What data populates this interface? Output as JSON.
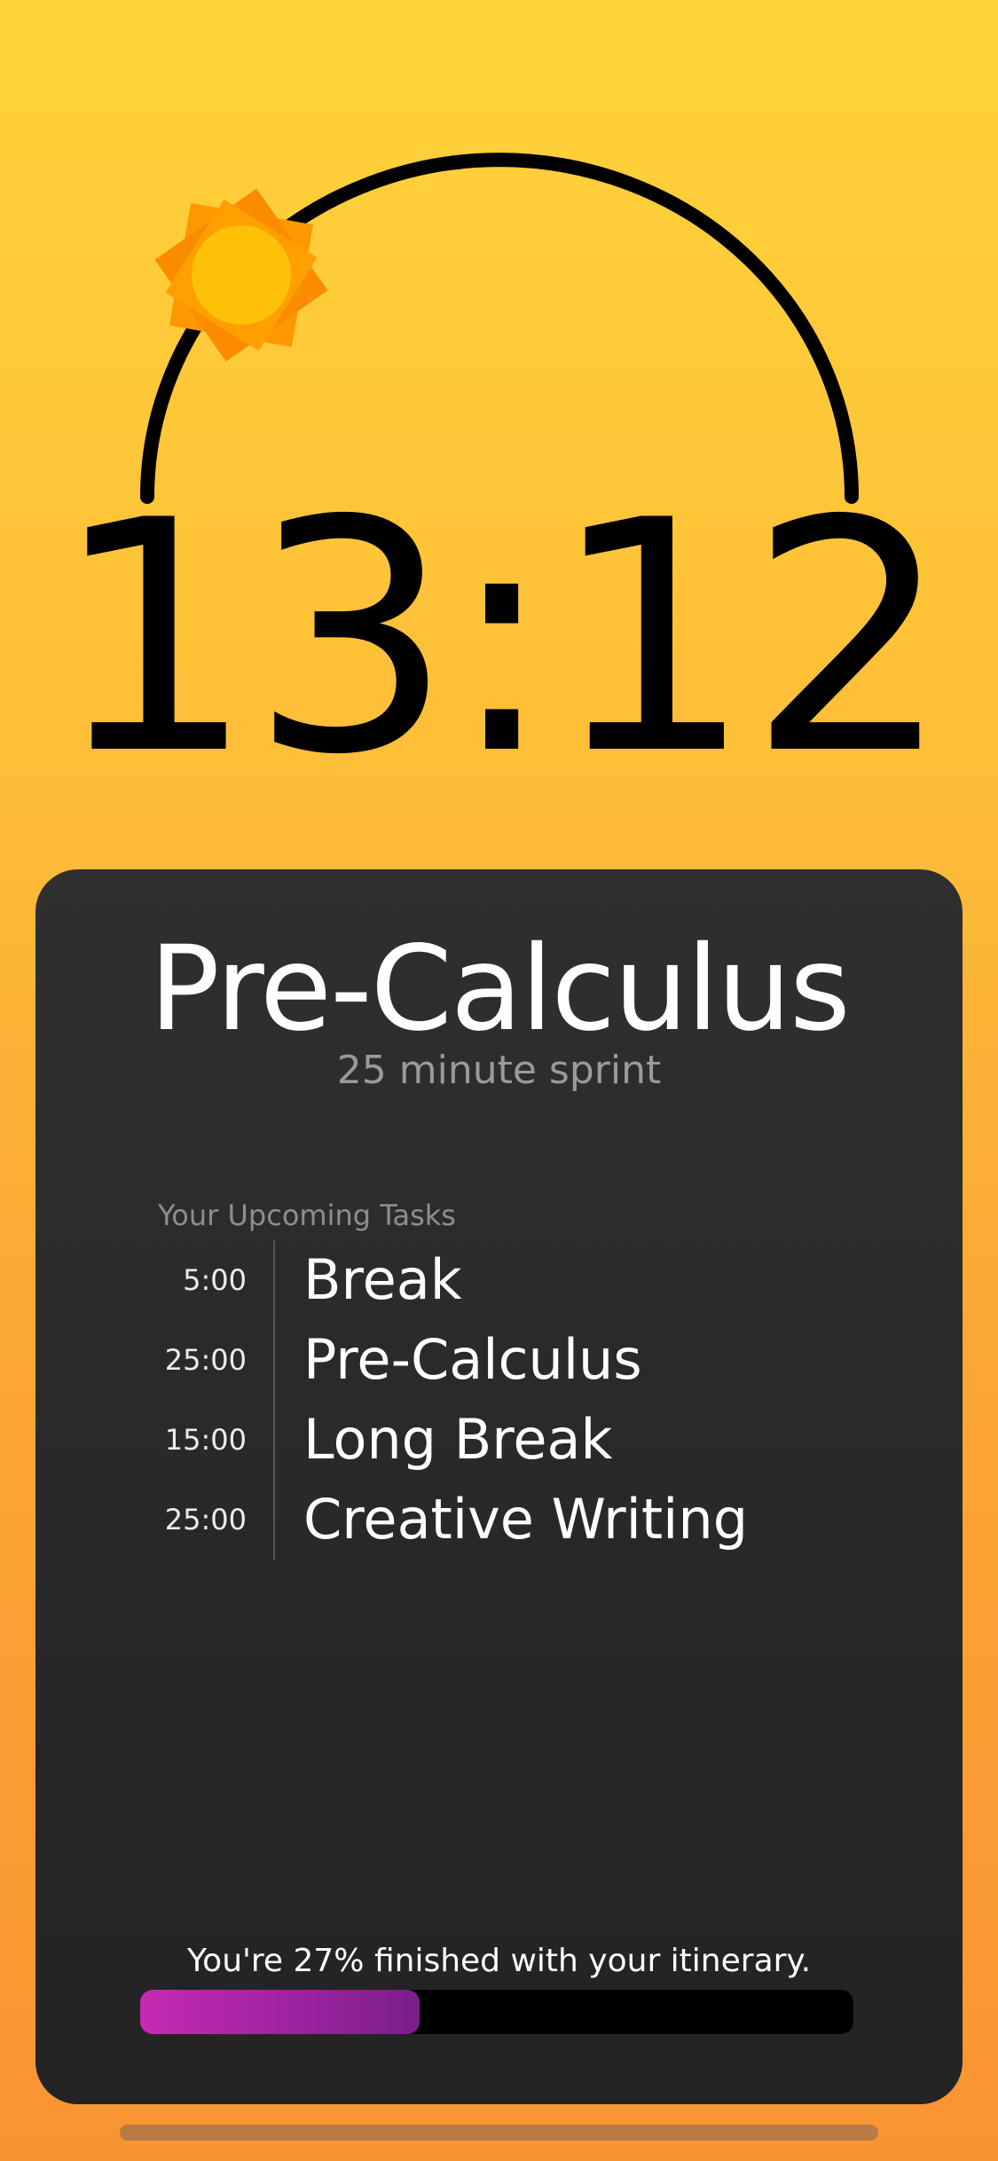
{
  "clock": {
    "time": "13:12"
  },
  "current_session": {
    "subject": "Pre-Calculus",
    "description": "25 minute sprint"
  },
  "upcoming": {
    "title": "Your Upcoming Tasks",
    "tasks": [
      {
        "duration": "5:00",
        "name": "Break"
      },
      {
        "duration": "25:00",
        "name": "Pre-Calculus"
      },
      {
        "duration": "15:00",
        "name": "Long Break"
      },
      {
        "duration": "25:00",
        "name": "Creative Writing"
      }
    ]
  },
  "progress": {
    "text": "You're 27% finished with your itinerary.",
    "percent": 27
  },
  "colors": {
    "background_top": "#FFD43A",
    "background_bottom": "#F99433",
    "card": "#2A2A2A",
    "progress_start": "#C62AB0",
    "progress_end": "#7B1E8C",
    "sun_outer": "#FB8C00",
    "sun_inner": "#FFC107"
  },
  "icons": {
    "sun": "sun-icon"
  }
}
